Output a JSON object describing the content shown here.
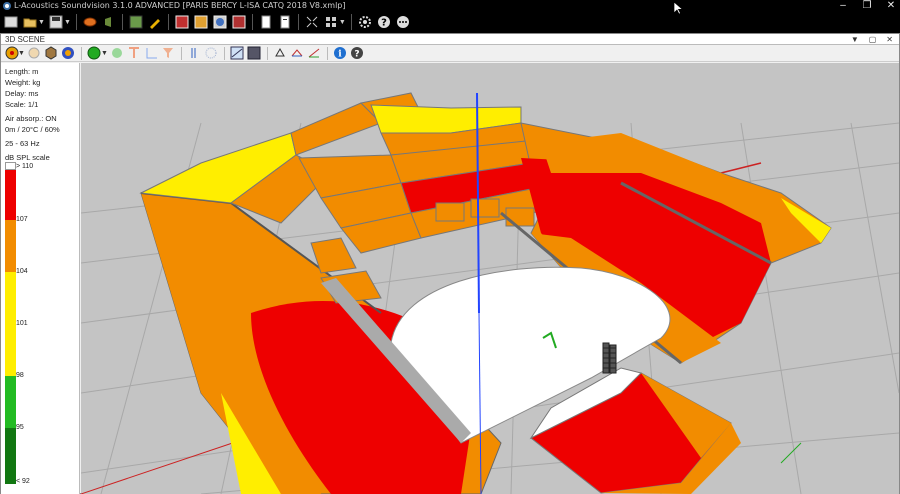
{
  "window": {
    "title": "L-Acoustics Soundvision 3.1.0 ADVANCED [PARIS BERCY L-ISA CATQ 2018 V8.xmlp]",
    "controls": [
      "minimize",
      "maximize",
      "close"
    ]
  },
  "main_toolbar": {
    "icons": [
      "folder-icon",
      "save-icon",
      "source-icon",
      "pencil-icon",
      "grid-icon",
      "pencil2-icon",
      "layers-icon",
      "mapping-icon",
      "sphere-icon",
      "film-icon",
      "document-icon",
      "report-icon",
      "expand-icon",
      "arrange-icon",
      "gear-icon",
      "help-icon",
      "more-icon"
    ]
  },
  "panel": {
    "title": "3D SCENE",
    "controls": [
      "▼",
      "▢",
      "✕"
    ]
  },
  "legend": {
    "units": {
      "length": "Length: m",
      "weight": "Weight: kg",
      "delay": "Delay: ms",
      "scale": "Scale: 1/1"
    },
    "air_absorp": "Air absorp.: ON",
    "atmos": "0m / 20°C / 60%",
    "freq": "25 - 63 Hz",
    "scale_title": "dB SPL scale",
    "ticks": [
      "> 110",
      "107",
      "104",
      "101",
      "98",
      "95",
      "< 92"
    ],
    "colors": {
      "white": "#ffffff",
      "red": "#ee0000",
      "orange": "#f28c00",
      "yellow": "#ffee00",
      "green": "#22bb22",
      "darkgreen": "#117711"
    }
  },
  "scene": {
    "background": "#c4c4c4",
    "axis_colors": {
      "z": "#2244ff",
      "x": "#cc2222",
      "y": "#22aa22"
    }
  }
}
